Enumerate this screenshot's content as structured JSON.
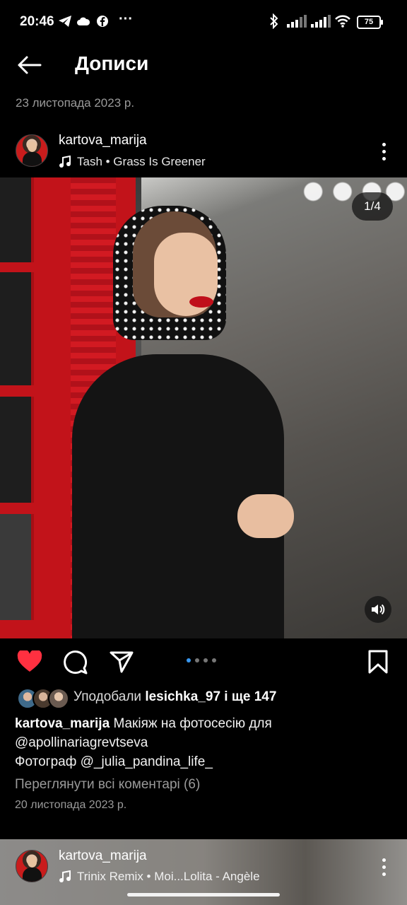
{
  "status_bar": {
    "time": "20:46",
    "battery": "75",
    "more": "···"
  },
  "header": {
    "title": "Дописи",
    "date": "23 листопада 2023 р."
  },
  "post": {
    "username": "kartova_marija",
    "music": "Tash • Grass Is Greener",
    "photo_counter": "1/4",
    "carousel": {
      "total": 4,
      "active_index": 0
    },
    "likes_prefix": "Уподобали",
    "likes_user": "lesichka_97",
    "likes_suffix": "і ще 147",
    "caption_username": "kartova_marija",
    "caption_line1": "Макіяж на фотосесію для",
    "caption_line2": "@apollinariagrevtseva",
    "caption_line3": "Фотограф @_julia_pandina_life_",
    "view_comments": "Переглянути всі коментарі (6)",
    "date": "20 листопада 2023 р.",
    "liked": true
  },
  "next_post": {
    "username": "kartova_marija",
    "music": "Trinix Remix • Moi...Lolita - Angèle"
  },
  "colors": {
    "background": "#000000",
    "like_red": "#ff3040",
    "carousel_active": "#3897f0",
    "muted_text": "#9a9a9a"
  },
  "icons": {
    "back": "arrow-left-icon",
    "like": "heart-icon",
    "comment": "comment-icon",
    "share": "send-icon",
    "save": "bookmark-icon",
    "sound": "speaker-icon",
    "music": "music-note-icon",
    "more": "kebab-icon"
  }
}
